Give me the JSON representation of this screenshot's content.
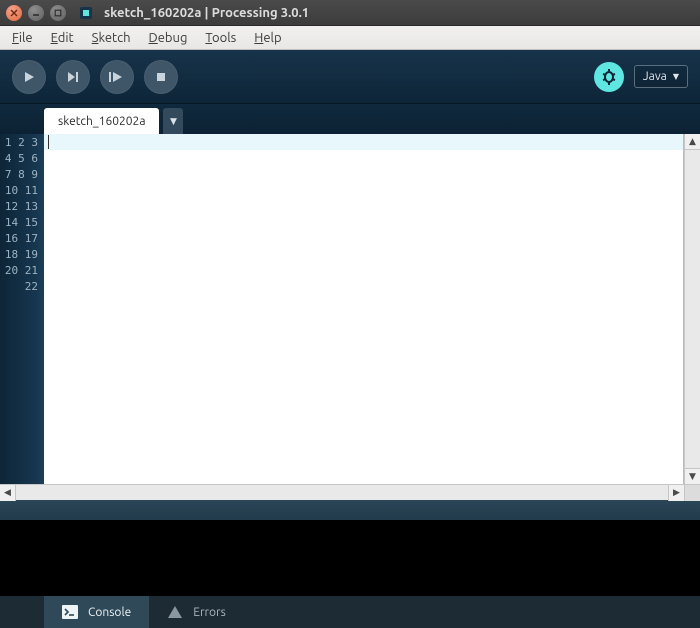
{
  "window": {
    "title": "sketch_160202a | Processing 3.0.1"
  },
  "menu": {
    "file": "File",
    "edit": "Edit",
    "sketch": "Sketch",
    "debug": "Debug",
    "tools": "Tools",
    "help": "Help"
  },
  "mode": {
    "label": "Java"
  },
  "tabs": {
    "active": "sketch_160202a"
  },
  "editor": {
    "line_count": 22,
    "current_line": 1
  },
  "bottom": {
    "console_label": "Console",
    "errors_label": "Errors"
  }
}
